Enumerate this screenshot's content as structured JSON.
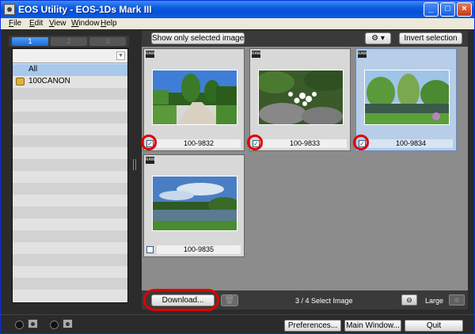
{
  "window": {
    "title": "EOS Utility - EOS-1Ds Mark III"
  },
  "menu": [
    {
      "label": "File",
      "key": "F",
      "rest": "ile"
    },
    {
      "label": "Edit",
      "key": "E",
      "rest": "dit"
    },
    {
      "label": "View",
      "key": "V",
      "rest": "iew"
    },
    {
      "label": "Window",
      "key": "W",
      "rest": "indow"
    },
    {
      "label": "Help",
      "key": "H",
      "rest": "elp"
    }
  ],
  "left_tabs": [
    "1",
    "2",
    "3"
  ],
  "folders": [
    {
      "label": "All",
      "selected": true
    },
    {
      "label": "100CANON",
      "selected": false
    }
  ],
  "toolbar": {
    "show_selected": "Show only selected images",
    "invert": "Invert selection"
  },
  "thumbnails": [
    {
      "name": "100-9832",
      "checked": true,
      "raw": "RAW"
    },
    {
      "name": "100-9833",
      "checked": true,
      "raw": "RAW"
    },
    {
      "name": "100-9834",
      "checked": true,
      "raw": "RAW"
    },
    {
      "name": "100-9835",
      "checked": false,
      "raw": "RAW"
    }
  ],
  "bottom": {
    "download": "Download...",
    "status": "3 / 4 Select Image",
    "size_label": "Large"
  },
  "footer": {
    "preferences": "Preferences...",
    "main_window": "Main Window...",
    "quit": "Quit"
  },
  "colors": {
    "accent": "#e00000",
    "titlebar": "#0a5ce0"
  }
}
